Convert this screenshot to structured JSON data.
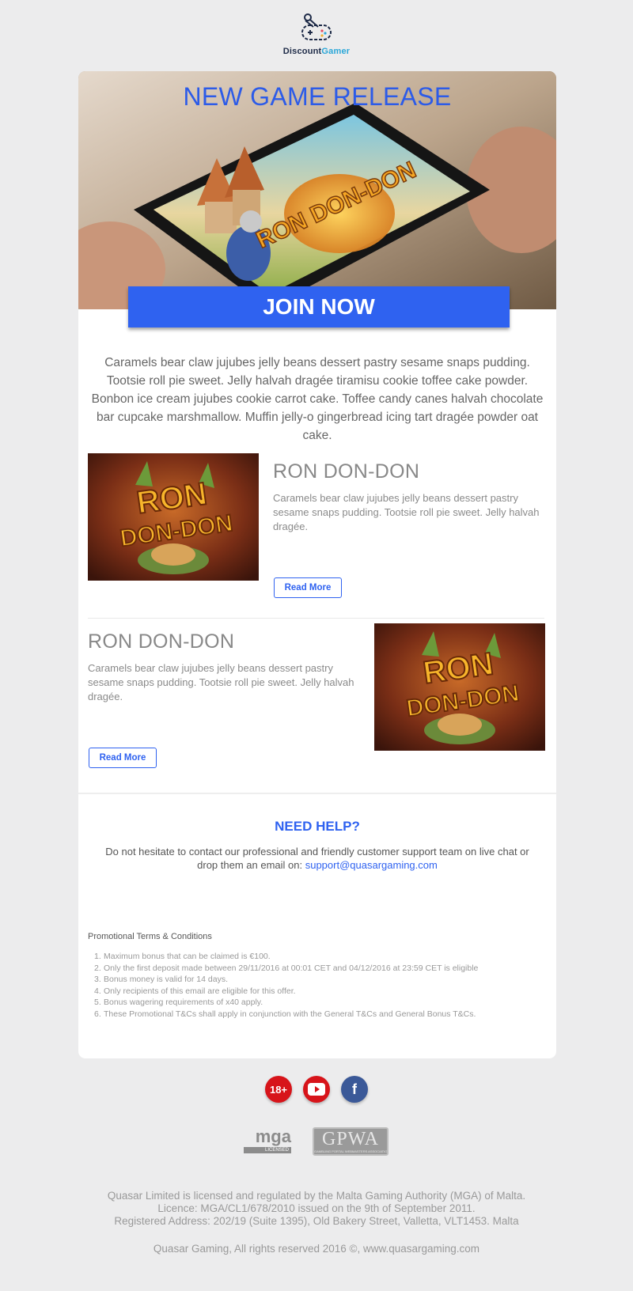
{
  "brand": {
    "part1": "Discount",
    "part2": "Gamer"
  },
  "hero": {
    "title": "NEW GAME RELEASE",
    "game_logo": "RON DON-DON",
    "cta_label": "JOIN NOW"
  },
  "intro_text": "Caramels bear claw jujubes jelly beans dessert pastry sesame snaps pudding. Tootsie roll pie sweet. Jelly halvah dragée tiramisu cookie toffee cake powder. Bonbon ice cream jujubes cookie carrot cake. Toffee candy canes halvah chocolate bar cupcake marshmallow. Muffin jelly-o gingerbread icing tart dragée powder oat cake.",
  "features": [
    {
      "title": "RON DON-DON",
      "description": "Caramels bear claw jujubes jelly beans dessert pastry sesame snaps pudding. Tootsie roll pie sweet. Jelly halvah dragée.",
      "button": "Read More",
      "image_text_1": "RON",
      "image_text_2": "DON-DON"
    },
    {
      "title": "RON DON-DON",
      "description": "Caramels bear claw jujubes jelly beans dessert pastry sesame snaps pudding. Tootsie roll pie sweet. Jelly halvah dragée.",
      "button": "Read More",
      "image_text_1": "RON",
      "image_text_2": "DON-DON"
    }
  ],
  "help": {
    "title": "NEED HELP?",
    "text": "Do not hesitate to contact our professional and friendly customer support team on live chat or drop them an email on: ",
    "email": "support@quasargaming.com"
  },
  "terms": {
    "title": "Promotional Terms & Conditions",
    "items": [
      "Maximum bonus that can be claimed is €100.",
      "Only the first deposit made between 29/11/2016 at 00:01 CET and 04/12/2016 at 23:59 CET is eligible",
      "Bonus money is valid for 14 days.",
      "Only recipients of this email are eligible for this offer.",
      "Bonus wagering requirements of x40 apply.",
      "These Promotional T&Cs shall apply in conjunction with the General T&Cs and General Bonus T&Cs."
    ]
  },
  "social": {
    "age_label": "18+",
    "icons": [
      "age-restriction-icon",
      "youtube-icon",
      "facebook-icon"
    ],
    "facebook_glyph": "f"
  },
  "badges": {
    "mga_main": "mga",
    "mga_sub": "LICENSED",
    "gpwa_main": "GPWA",
    "gpwa_sub": "GAMBLING PORTAL WEBMASTERS ASSOCIATION"
  },
  "footer": {
    "line1": "Quasar Limited is licensed and regulated by the Malta Gaming Authority (MGA) of Malta.",
    "line2": "Licence: MGA/CL1/678/2010 issued on the 9th of September 2011.",
    "line3": "Registered Address: 202/19 (Suite 1395), Old Bakery Street, Valletta, VLT1453. Malta",
    "copyright": "Quasar Gaming, All rights reserved 2016 ©, www.quasargaming.com"
  },
  "colors": {
    "accent": "#2f62f0",
    "background": "#ececed",
    "card": "#ffffff"
  }
}
